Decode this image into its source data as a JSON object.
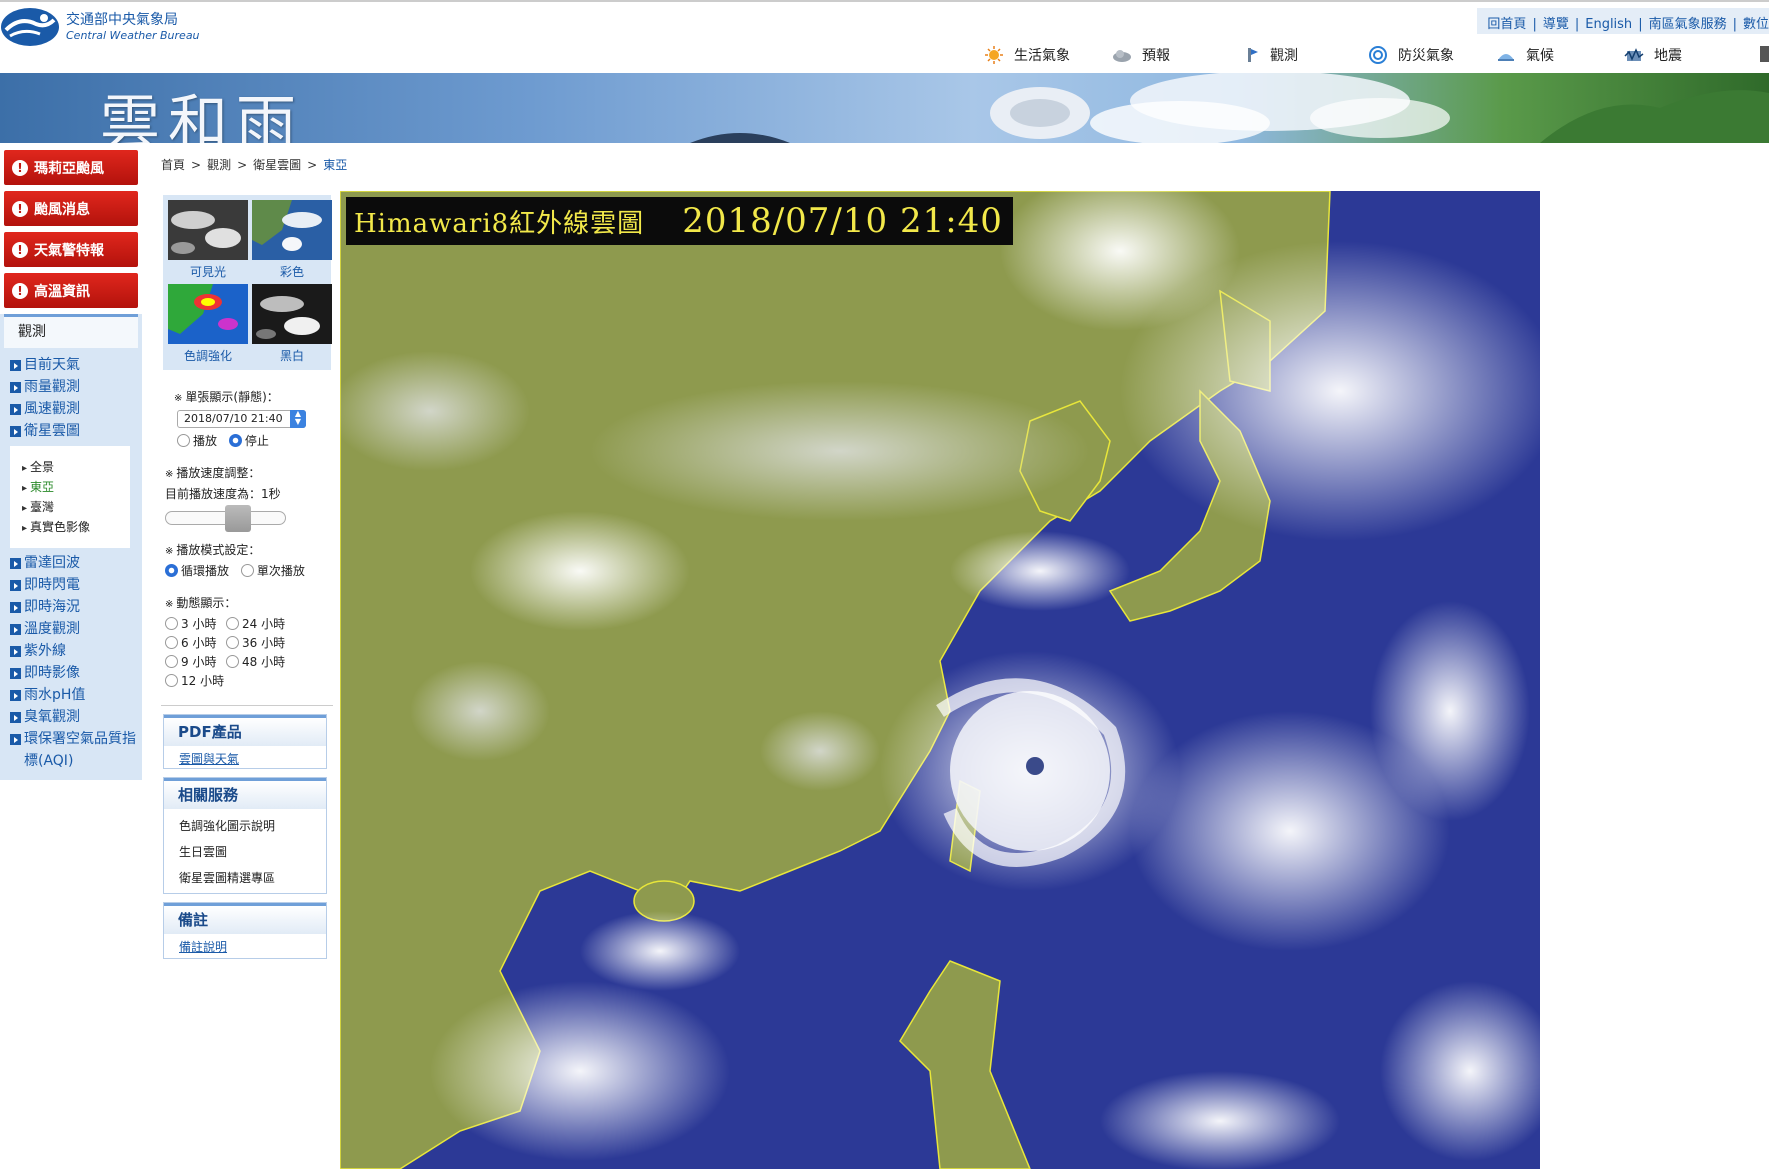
{
  "header": {
    "org_zh": "交通部中央氣象局",
    "org_en": "Central Weather Bureau",
    "top_links": [
      "回首頁",
      "導覽",
      "English",
      "南區氣象服務",
      "數位"
    ],
    "nav": [
      {
        "label": "生活氣象",
        "icon": "sun-icon"
      },
      {
        "label": "預報",
        "icon": "cloud-icon"
      },
      {
        "label": "觀測",
        "icon": "instrument-icon"
      },
      {
        "label": "防災氣象",
        "icon": "typhoon-icon"
      },
      {
        "label": "氣候",
        "icon": "climate-icon"
      },
      {
        "label": "地震",
        "icon": "earthquake-icon"
      }
    ]
  },
  "banner": {
    "title": "雲和雨"
  },
  "alerts": [
    "瑪莉亞颱風",
    "颱風消息",
    "天氣警特報",
    "高溫資訊"
  ],
  "sidebar": {
    "section": "觀測",
    "items_top": [
      "目前天氣",
      "雨量觀測",
      "風速觀測",
      "衛星雲圖"
    ],
    "sub_items": [
      {
        "label": "全景",
        "selected": false
      },
      {
        "label": "東亞",
        "selected": true
      },
      {
        "label": "臺灣",
        "selected": false
      },
      {
        "label": "真實色影像",
        "selected": false
      }
    ],
    "items_bottom": [
      "雷達回波",
      "即時閃電",
      "即時海況",
      "溫度觀測",
      "紫外線",
      "即時影像",
      "雨水pH值",
      "臭氧觀測",
      "環保署空氣品質指標(AQI)"
    ]
  },
  "breadcrumb": [
    "首頁",
    "觀測",
    "衛星雲圖",
    "東亞"
  ],
  "thumbs": [
    "可見光",
    "彩色",
    "色調強化",
    "黑白"
  ],
  "controls": {
    "single_label": "單張顯示(靜態)：",
    "time_value": "2018/07/10 21:40",
    "play": "播放",
    "stop": "停止",
    "speed_label": "播放速度調整：",
    "speed_now": "目前播放速度為：1秒",
    "speed_fraction": 0.63,
    "mode_label": "播放模式設定：",
    "mode_loop": "循環播放",
    "mode_once": "單次播放",
    "dynamic_label": "動態顯示：",
    "hours": [
      "3 小時",
      "24 小時",
      "6 小時",
      "36 小時",
      "9 小時",
      "48 小時",
      "12 小時"
    ]
  },
  "pdf_box": {
    "title": "PDF產品",
    "link": "雲圖與天氣"
  },
  "service_box": {
    "title": "相關服務",
    "items": [
      "色調強化圖示說明",
      "生日雲圖",
      "衛星雲圖精選專區"
    ]
  },
  "note_box": {
    "title": "備註",
    "link": "備註說明"
  },
  "satellite": {
    "title_a": "Himawari8紅外線雲圖",
    "title_b": "2018/07/10 21:40"
  },
  "colors": {
    "accent": "#1a5aa8",
    "alert": "#c21710",
    "land": "#8e9a4e",
    "sea": "#2d3a9a",
    "coast": "#e8e63a"
  }
}
